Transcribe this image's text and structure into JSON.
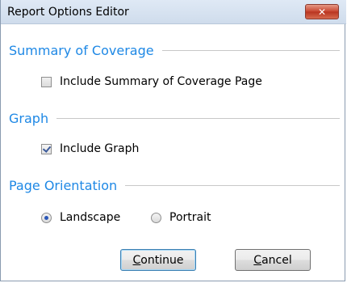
{
  "window": {
    "title": "Report Options Editor",
    "close_symbol": "✕"
  },
  "sections": {
    "summary": {
      "title": "Summary of Coverage",
      "option_label": "Include Summary of Coverage Page",
      "checked": false
    },
    "graph": {
      "title": "Graph",
      "option_label": "Include Graph",
      "checked": true
    },
    "orientation": {
      "title": "Page Orientation",
      "options": [
        {
          "label": "Landscape",
          "selected": true
        },
        {
          "label": "Portrait",
          "selected": false
        }
      ]
    }
  },
  "buttons": {
    "continue": {
      "first": "C",
      "rest": "ontinue"
    },
    "cancel": {
      "first": "C",
      "rest": "ancel"
    }
  }
}
